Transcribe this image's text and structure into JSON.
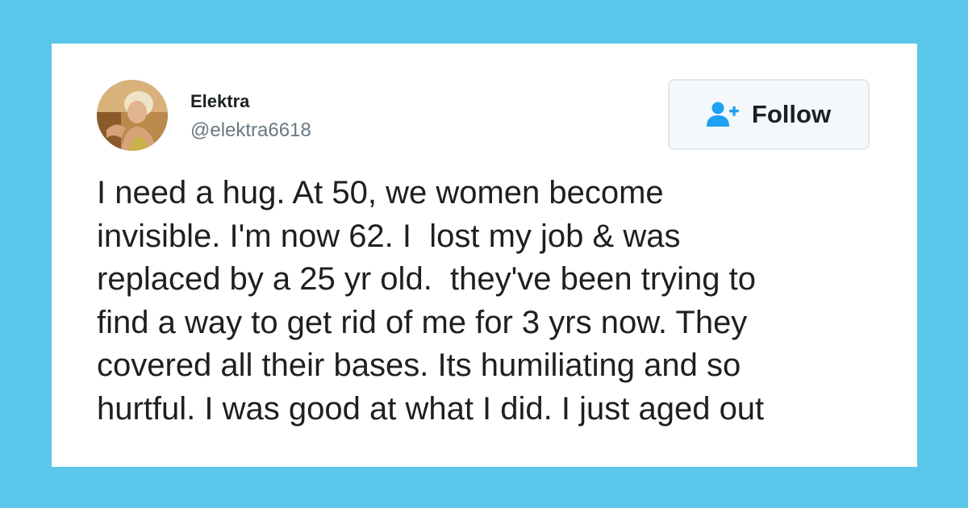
{
  "colors": {
    "background": "#59c6ea",
    "card": "#ffffff",
    "text": "#1c2022",
    "secondary_text": "#697882",
    "accent": "#1da1f2"
  },
  "user": {
    "name": "Elektra",
    "handle": "@elektra6618",
    "avatar_icon": "profile-photo"
  },
  "follow_button": {
    "label": "Follow",
    "icon": "add-user-icon"
  },
  "tweet": {
    "lines": [
      "I need a hug. At 50, we women become",
      "invisible. I'm now 62. I  lost my job & was",
      "replaced by a 25 yr old.  they've been trying to",
      "find a way to get rid of me for 3 yrs now. They",
      "covered all their bases. Its humiliating and so",
      "hurtful. I was good at what I did. I just aged out"
    ]
  }
}
